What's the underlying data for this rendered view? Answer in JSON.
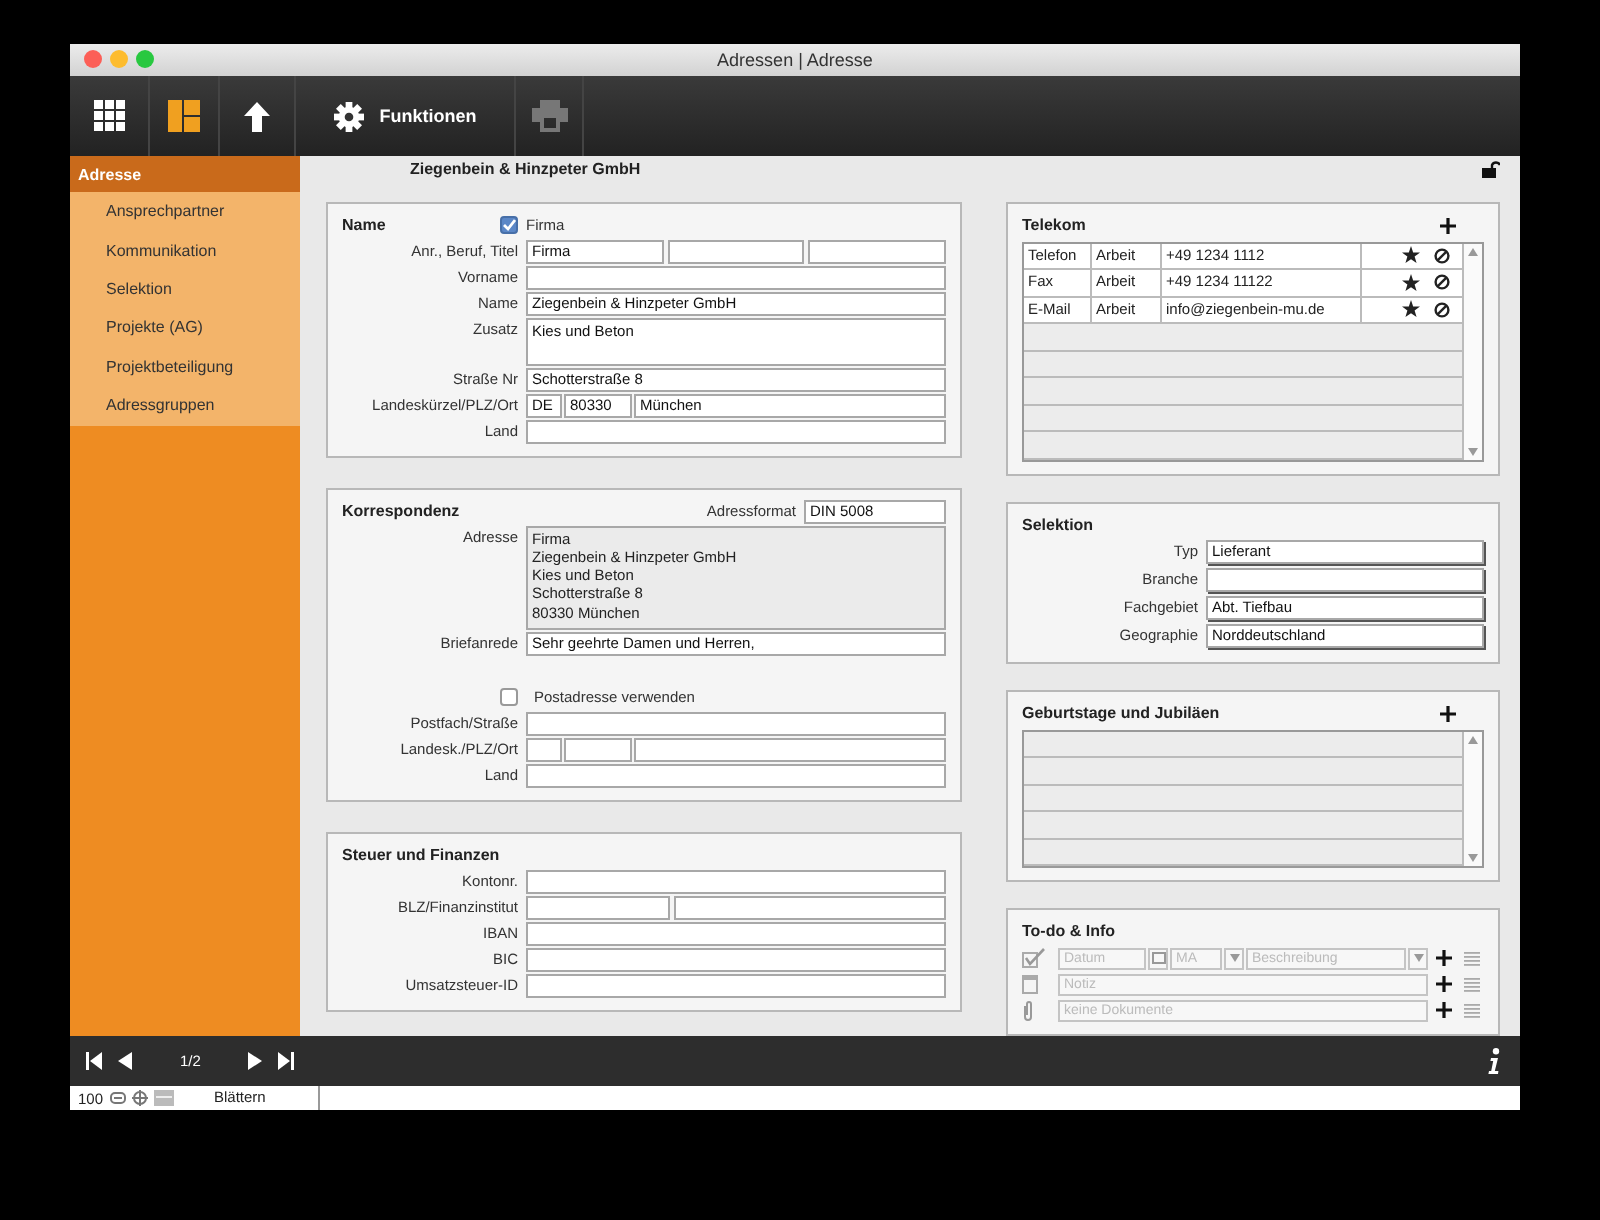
{
  "window": {
    "title": "Adressen | Adresse"
  },
  "toolbar": [
    {
      "kind": "grid",
      "selected": false,
      "disabled": false
    },
    {
      "kind": "layout",
      "selected": true,
      "disabled": false
    },
    {
      "kind": "up",
      "selected": false,
      "disabled": false
    },
    {
      "kind": "gear",
      "label": "Funktionen",
      "selected": false,
      "disabled": false
    },
    {
      "kind": "print",
      "selected": false,
      "disabled": true
    }
  ],
  "sidebar": {
    "items": [
      {
        "label": "Adresse",
        "selected": true
      },
      {
        "label": "Ansprechpartner",
        "selected": false
      },
      {
        "label": "Kommunikation",
        "selected": false
      },
      {
        "label": "Selektion",
        "selected": false
      },
      {
        "label": "Projekte (AG)",
        "selected": false
      },
      {
        "label": "Projektbeteiligung",
        "selected": false
      },
      {
        "label": "Adressgruppen",
        "selected": false
      }
    ]
  },
  "header": {
    "title": "Ziegenbein & Hinzpeter GmbH",
    "locked": false
  },
  "left_panels": [
    {
      "title": "Name",
      "checkbox": {
        "label": "Firma",
        "checked": true
      },
      "rows": [
        {
          "kind": "three",
          "label": "Anr., Beruf, Titel",
          "values": [
            "Firma"
          ]
        },
        {
          "kind": "text",
          "label": "Vorname"
        },
        {
          "kind": "text",
          "label": "Name",
          "values": [
            "Ziegenbein & Hinzpeter GmbH"
          ]
        },
        {
          "kind": "area",
          "label": "Zusatz",
          "values": [
            "Kies und Beton"
          ]
        },
        {
          "kind": "text",
          "label": "Straße Nr",
          "values": [
            "Schotterstraße 8"
          ]
        },
        {
          "kind": "place",
          "label": "Landeskürzel/PLZ/Ort",
          "values": [
            "DE",
            "80330",
            "München"
          ]
        },
        {
          "kind": "text",
          "label": "Land"
        }
      ]
    },
    {
      "title": "Korrespondenz",
      "format": {
        "label": "Adressformat",
        "value": "DIN 5008"
      },
      "rows": [
        {
          "kind": "block",
          "label": "Adresse",
          "values": [
            "Firma",
            "Ziegenbein & Hinzpeter GmbH",
            "Kies und Beton",
            "Schotterstraße 8",
            "80330 München"
          ]
        },
        {
          "kind": "text",
          "label": "Briefanrede",
          "values": [
            "Sehr geehrte Damen und Herren,"
          ]
        },
        {
          "kind": "check",
          "label": "Postadresse verwenden",
          "checked": false
        },
        {
          "kind": "text",
          "label": "Postfach/Straße"
        },
        {
          "kind": "place",
          "label": "Landesk./PLZ/Ort"
        },
        {
          "kind": "text",
          "label": "Land"
        }
      ]
    },
    {
      "title": "Steuer und Finanzen",
      "rows": [
        {
          "kind": "text",
          "label": "Kontonr."
        },
        {
          "kind": "two",
          "label": "BLZ/Finanzinstitut"
        },
        {
          "kind": "text",
          "label": "IBAN"
        },
        {
          "kind": "text",
          "label": "BIC"
        },
        {
          "kind": "text",
          "label": "Umsatzsteuer-ID"
        }
      ]
    }
  ],
  "telekom": {
    "title": "Telekom",
    "rows": [
      {
        "type": "Telefon",
        "category": "Arbeit",
        "value": "+49 1234 1112"
      },
      {
        "type": "Fax",
        "category": "Arbeit",
        "value": "+49 1234 11122"
      },
      {
        "type": "E-Mail",
        "category": "Arbeit",
        "value": "info@ziegenbein-mu.de"
      }
    ]
  },
  "selektion": {
    "title": "Selektion",
    "rows": [
      {
        "label": "Typ",
        "value": "Lieferant"
      },
      {
        "label": "Branche"
      },
      {
        "label": "Fachgebiet",
        "value": "Abt. Tiefbau"
      },
      {
        "label": "Geographie",
        "value": "Norddeutschland"
      }
    ]
  },
  "birthdays": {
    "title": "Geburtstage und Jubiläen"
  },
  "todo": {
    "title": "To-do & Info",
    "rows": [
      {
        "kind": "task",
        "placeholders": [
          "Datum",
          "MA",
          "Beschreibung"
        ]
      },
      {
        "kind": "note",
        "placeholders": [
          "Notiz"
        ]
      },
      {
        "kind": "document",
        "placeholders": [
          "keine Dokumente"
        ]
      }
    ]
  },
  "pager": {
    "page": "1/2"
  },
  "status_bar": {
    "zoom": "100",
    "mode": "Blättern"
  }
}
